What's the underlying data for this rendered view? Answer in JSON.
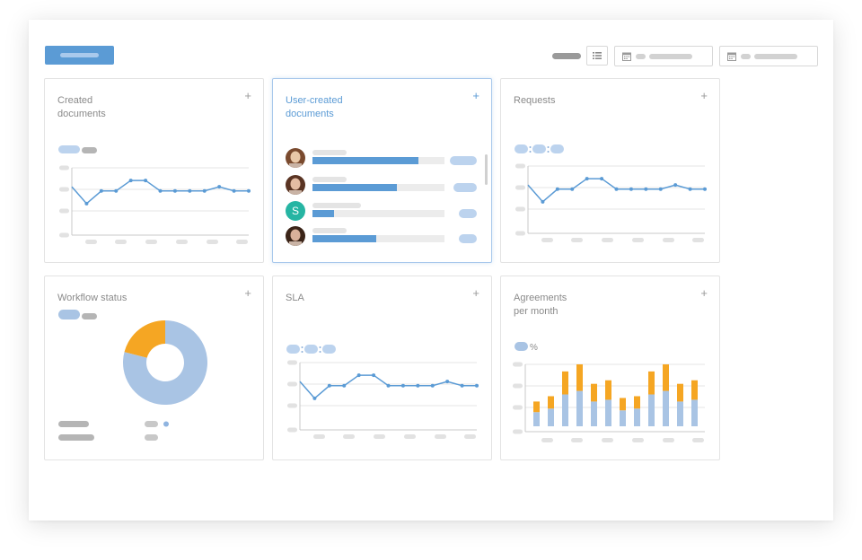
{
  "colors": {
    "accent": "#5b9bd5",
    "line": "#5b9bd5",
    "donut_light": "#a9c4e4",
    "donut_orange": "#f5a623",
    "bar_blue": "#a9c4e4",
    "bar_orange": "#f5a623",
    "placeholder": "#d9d9d9"
  },
  "toolbar": {
    "list_icon": "list-icon",
    "calendar_icon": "calendar-icon"
  },
  "cards": {
    "created_documents": {
      "title": "Created\ndocuments",
      "plus": "+",
      "series": [
        2.3,
        1.5,
        2.1,
        2.1,
        2.6,
        2.6,
        2.1,
        2.1,
        2.1,
        2.1,
        2.3,
        2.1,
        2.1
      ]
    },
    "user_created_documents": {
      "title": "User-created\ndocuments",
      "plus": "+",
      "users": [
        {
          "avatar": "photo",
          "fill": 0.8
        },
        {
          "avatar": "photo",
          "fill": 0.64
        },
        {
          "avatar": "S",
          "fill": 0.16
        },
        {
          "avatar": "photo",
          "fill": 0.48
        }
      ]
    },
    "requests": {
      "title": "Requests",
      "plus": "+",
      "series": [
        2.3,
        1.5,
        2.1,
        2.1,
        2.6,
        2.6,
        2.1,
        2.1,
        2.1,
        2.1,
        2.3,
        2.1,
        2.1
      ]
    },
    "workflow_status": {
      "title": "Workflow status",
      "plus": "+",
      "donut": {
        "orange_fraction": 0.21,
        "blue_fraction": 0.79
      }
    },
    "sla": {
      "title": "SLA",
      "plus": "+",
      "series": [
        2.3,
        1.5,
        2.1,
        2.1,
        2.6,
        2.6,
        2.1,
        2.1,
        2.1,
        2.1,
        2.3,
        2.1,
        2.1
      ]
    },
    "agreements_per_month": {
      "title": "Agreements\nper month",
      "plus": "+",
      "legend_unit": "%",
      "bars": [
        {
          "blue": 0.8,
          "orange": 0.6
        },
        {
          "blue": 1.0,
          "orange": 0.7
        },
        {
          "blue": 1.8,
          "orange": 1.3
        },
        {
          "blue": 2.0,
          "orange": 1.5
        },
        {
          "blue": 1.4,
          "orange": 1.0
        },
        {
          "blue": 1.5,
          "orange": 1.1
        },
        {
          "blue": 0.9,
          "orange": 0.7
        },
        {
          "blue": 1.0,
          "orange": 0.7
        },
        {
          "blue": 1.8,
          "orange": 1.3
        },
        {
          "blue": 2.0,
          "orange": 1.5
        },
        {
          "blue": 1.4,
          "orange": 1.0
        },
        {
          "blue": 1.5,
          "orange": 1.1
        }
      ]
    }
  }
}
